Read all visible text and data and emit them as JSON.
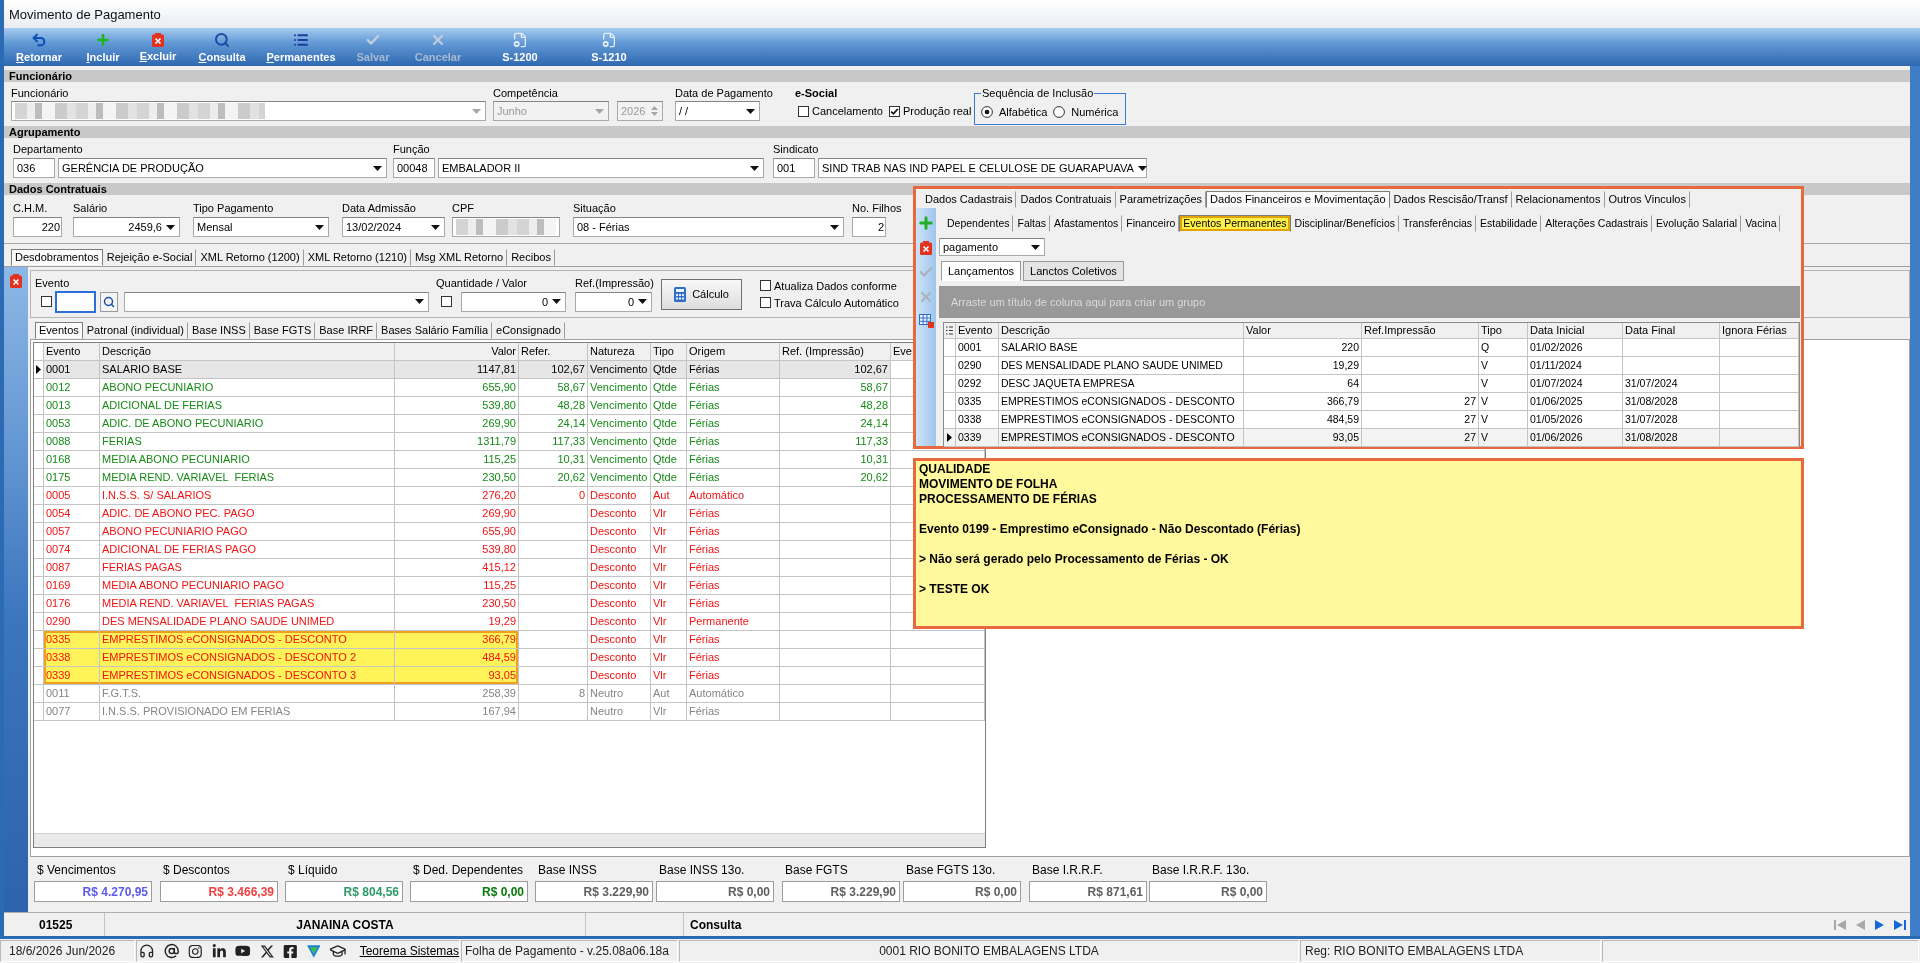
{
  "window": {
    "title": "Movimento de Pagamento"
  },
  "toolbar": [
    {
      "label": "Retornar",
      "kind": "back",
      "shortcut": true,
      "disabled": false
    },
    {
      "label": "Incluir",
      "kind": "add",
      "shortcut": true,
      "disabled": false
    },
    {
      "label": "Excluir",
      "kind": "delete",
      "shortcut": true,
      "disabled": false
    },
    {
      "label": "Consulta",
      "kind": "search",
      "shortcut": true,
      "disabled": false
    },
    {
      "label": "Permanentes",
      "kind": "list",
      "shortcut": true,
      "disabled": false
    },
    {
      "label": "Salvar",
      "kind": "save",
      "shortcut": false,
      "disabled": true
    },
    {
      "label": "Cancelar",
      "kind": "cancel",
      "shortcut": false,
      "disabled": true
    },
    {
      "label": "S-1200",
      "kind": "document",
      "shortcut": false,
      "disabled": false
    },
    {
      "label": "S-1210",
      "kind": "document",
      "shortcut": false,
      "disabled": false
    }
  ],
  "funcionario": {
    "header": "Funcionário",
    "employee": {
      "label": "Funcionário",
      "disabled": true
    },
    "competencia": {
      "label": "Competência",
      "value": "Junho",
      "year": "2026",
      "disabled": true
    },
    "data_pagamento": {
      "label": "Data de Pagamento",
      "value": "/ /"
    },
    "esocial": {
      "label": "e-Social",
      "options": [
        {
          "label": "Cancelamento",
          "checked": false
        },
        {
          "label": "Produção real",
          "checked": true
        }
      ]
    },
    "sequencia": {
      "label": "Sequência de Inclusão",
      "options": [
        {
          "label": "Alfabética",
          "selected": true
        },
        {
          "label": "Numérica",
          "selected": false
        }
      ]
    }
  },
  "agrupamento": {
    "header": "Agrupamento",
    "fields": [
      {
        "label": "Departamento",
        "code": "036",
        "value": "GERÊNCIA DE PRODUÇÃO"
      },
      {
        "label": "Função",
        "code": "00048",
        "value": "EMBALADOR II"
      },
      {
        "label": "Sindicato",
        "code": "001",
        "value": "SIND TRAB NAS IND PAPEL E CELULOSE DE GUARAPUAVA"
      }
    ]
  },
  "dados_contratuais": {
    "header": "Dados Contratuais",
    "fields": [
      {
        "label": "C.H.M.",
        "value": "220",
        "kind": "number"
      },
      {
        "label": "Salário",
        "value": "2459,6",
        "kind": "number_dropdown"
      },
      {
        "label": "Tipo Pagamento",
        "value": "Mensal",
        "kind": "dropdown"
      },
      {
        "label": "Data Admissão",
        "value": "13/02/2024",
        "kind": "dropdown"
      },
      {
        "label": "CPF",
        "kind": "blurred"
      },
      {
        "label": "Situação",
        "value": "08 - Férias",
        "kind": "dropdown"
      },
      {
        "label": "No. Filhos",
        "value": "2",
        "kind": "number"
      }
    ]
  },
  "main_tabs": [
    {
      "label": "Desdobramentos",
      "selected": true
    },
    {
      "label": "Rejeição e-Social",
      "selected": false
    },
    {
      "label": "XML Retorno (1200)",
      "selected": false
    },
    {
      "label": "XML Retorno (1210)",
      "selected": false
    },
    {
      "label": "Msg XML Retorno",
      "selected": false
    },
    {
      "label": "Recibos",
      "selected": false
    }
  ],
  "evento_panel": {
    "evento": {
      "label": "Evento",
      "checked": false,
      "focused": true
    },
    "quantidade": {
      "label": "Quantidade / Valor",
      "checked": false,
      "value": "0"
    },
    "ref_impressao": {
      "label": "Ref.(Impressão)",
      "value": "0"
    },
    "calculate_button": "Cálculo",
    "options": [
      {
        "label": "Atualiza Dados conforme",
        "checked": false
      },
      {
        "label": "Trava Cálculo Automático",
        "checked": false
      }
    ]
  },
  "event_tabs": [
    {
      "label": "Eventos",
      "selected": true
    },
    {
      "label": "Patronal (individual)",
      "selected": false
    },
    {
      "label": "Base INSS",
      "selected": false
    },
    {
      "label": "Base FGTS",
      "selected": false
    },
    {
      "label": "Base IRRF",
      "selected": false
    },
    {
      "label": "Bases Salário Família",
      "selected": false
    },
    {
      "label": "eConsignado",
      "selected": false
    }
  ],
  "events_table": {
    "columns": [
      "Evento",
      "Descrição",
      "Valor",
      "Refer.",
      "Natureza",
      "Tipo",
      "Origem",
      "Ref. (Impressão)",
      "Eve"
    ],
    "rows": [
      {
        "evento": "0001",
        "descricao": "SALARIO BASE",
        "valor": "1147,81",
        "refer": "102,67",
        "natureza": "Vencimento",
        "tipo": "Qtde",
        "origem": "Férias",
        "ref_impressao": "102,67",
        "selected": true,
        "highlighted": false
      },
      {
        "evento": "0012",
        "descricao": "ABONO PECUNIARIO",
        "valor": "655,90",
        "refer": "58,67",
        "natureza": "Vencimento",
        "tipo": "Qtde",
        "origem": "Férias",
        "ref_impressao": "58,67",
        "kind": "vencimento",
        "selected": false,
        "highlighted": false
      },
      {
        "evento": "0013",
        "descricao": "ADICIONAL DE FERIAS",
        "valor": "539,80",
        "refer": "48,28",
        "natureza": "Vencimento",
        "tipo": "Qtde",
        "origem": "Férias",
        "ref_impressao": "48,28",
        "kind": "vencimento",
        "selected": false,
        "highlighted": false
      },
      {
        "evento": "0053",
        "descricao": "ADIC. DE ABONO PECUNIARIO",
        "valor": "269,90",
        "refer": "24,14",
        "natureza": "Vencimento",
        "tipo": "Qtde",
        "origem": "Férias",
        "ref_impressao": "24,14",
        "kind": "vencimento",
        "selected": false,
        "highlighted": false
      },
      {
        "evento": "0088",
        "descricao": "FERIAS",
        "valor": "1311,79",
        "refer": "117,33",
        "natureza": "Vencimento",
        "tipo": "Qtde",
        "origem": "Férias",
        "ref_impressao": "117,33",
        "kind": "vencimento",
        "selected": false,
        "highlighted": false
      },
      {
        "evento": "0168",
        "descricao": "MEDIA ABONO PECUNIARIO",
        "valor": "115,25",
        "refer": "10,31",
        "natureza": "Vencimento",
        "tipo": "Qtde",
        "origem": "Férias",
        "ref_impressao": "10,31",
        "kind": "vencimento",
        "selected": false,
        "highlighted": false
      },
      {
        "evento": "0175",
        "descricao": "MEDIA REND. VARIAVEL  FERIAS",
        "valor": "230,50",
        "refer": "20,62",
        "natureza": "Vencimento",
        "tipo": "Qtde",
        "origem": "Férias",
        "ref_impressao": "20,62",
        "kind": "vencimento",
        "selected": false,
        "highlighted": false
      },
      {
        "evento": "0005",
        "descricao": "I.N.S.S. S/ SALARIOS",
        "valor": "276,20",
        "refer": "0",
        "natureza": "Desconto",
        "tipo": "Aut",
        "origem": "Automático",
        "kind": "desconto",
        "selected": false,
        "highlighted": false
      },
      {
        "evento": "0054",
        "descricao": "ADIC. DE ABONO PEC. PAGO",
        "valor": "269,90",
        "natureza": "Desconto",
        "tipo": "Vlr",
        "origem": "Férias",
        "kind": "desconto",
        "selected": false,
        "highlighted": false
      },
      {
        "evento": "0057",
        "descricao": "ABONO PECUNIARIO PAGO",
        "valor": "655,90",
        "natureza": "Desconto",
        "tipo": "Vlr",
        "origem": "Férias",
        "kind": "desconto",
        "selected": false,
        "highlighted": false
      },
      {
        "evento": "0074",
        "descricao": "ADICIONAL DE FERIAS PAGO",
        "valor": "539,80",
        "natureza": "Desconto",
        "tipo": "Vlr",
        "origem": "Férias",
        "kind": "desconto",
        "selected": false,
        "highlighted": false
      },
      {
        "evento": "0087",
        "descricao": "FERIAS PAGAS",
        "valor": "415,12",
        "natureza": "Desconto",
        "tipo": "Vlr",
        "origem": "Férias",
        "kind": "desconto",
        "selected": false,
        "highlighted": false
      },
      {
        "evento": "0169",
        "descricao": "MEDIA ABONO PECUNIARIO PAGO",
        "valor": "115,25",
        "natureza": "Desconto",
        "tipo": "Vlr",
        "origem": "Férias",
        "kind": "desconto",
        "selected": false,
        "highlighted": false
      },
      {
        "evento": "0176",
        "descricao": "MEDIA REND. VARIAVEL  FERIAS PAGAS",
        "valor": "230,50",
        "natureza": "Desconto",
        "tipo": "Vlr",
        "origem": "Férias",
        "kind": "desconto",
        "selected": false,
        "highlighted": false
      },
      {
        "evento": "0290",
        "descricao": "DES MENSALIDADE PLANO SAUDE UNIMED",
        "valor": "19,29",
        "natureza": "Desconto",
        "tipo": "Vlr",
        "origem": "Permanente",
        "kind": "desconto",
        "selected": false,
        "highlighted": false
      },
      {
        "evento": "0335",
        "descricao": "EMPRESTIMOS eCONSIGNADOS - DESCONTO",
        "valor": "366,79",
        "natureza": "Desconto",
        "tipo": "Vlr",
        "origem": "Férias",
        "kind": "desconto",
        "selected": false,
        "highlighted": true
      },
      {
        "evento": "0338",
        "descricao": "EMPRESTIMOS eCONSIGNADOS - DESCONTO 2",
        "valor": "484,59",
        "natureza": "Desconto",
        "tipo": "Vlr",
        "origem": "Férias",
        "kind": "desconto",
        "selected": false,
        "highlighted": true
      },
      {
        "evento": "0339",
        "descricao": "EMPRESTIMOS eCONSIGNADOS - DESCONTO 3",
        "valor": "93,05",
        "natureza": "Desconto",
        "tipo": "Vlr",
        "origem": "Férias",
        "kind": "desconto",
        "selected": false,
        "highlighted": true
      },
      {
        "evento": "0011",
        "descricao": "F.G.T.S.",
        "valor": "258,39",
        "refer": "8",
        "natureza": "Neutro",
        "tipo": "Aut",
        "origem": "Automático",
        "kind": "neutro",
        "selected": false,
        "highlighted": false
      },
      {
        "evento": "0077",
        "descricao": "I.N.S.S. PROVISIONADO EM FERIAS",
        "valor": "167,94",
        "natureza": "Neutro",
        "tipo": "Vlr",
        "origem": "Férias",
        "kind": "neutro",
        "selected": false,
        "highlighted": false
      }
    ]
  },
  "totals": [
    {
      "label": "$ Vencimentos",
      "value": "R$ 4.270,95",
      "color": "#5a5af0"
    },
    {
      "label": "$ Descontos",
      "value": "R$ 3.466,39",
      "color": "#f04040"
    },
    {
      "label": "$ Líquido",
      "value": "R$ 804,56",
      "color": "#2e9a6a"
    },
    {
      "label": "$ Ded. Dependentes",
      "value": "R$ 0,00",
      "color": "#0a7a0a"
    },
    {
      "label": "Base INSS",
      "value": "R$ 3.229,90",
      "color": "#5f5f5f"
    },
    {
      "label": "Base INSS 13o.",
      "value": "R$ 0,00",
      "color": "#5f5f5f"
    },
    {
      "label": "Base FGTS",
      "value": "R$ 3.229,90",
      "color": "#5f5f5f"
    },
    {
      "label": "Base FGTS 13o.",
      "value": "R$ 0,00",
      "color": "#5f5f5f"
    },
    {
      "label": "Base I.R.R.F.",
      "value": "R$ 871,61",
      "color": "#5f5f5f"
    },
    {
      "label": "Base I.R.R.F. 13o.",
      "value": "R$ 0,00",
      "color": "#5f5f5f"
    }
  ],
  "record_bar": {
    "code": "01525",
    "name": "JANAINA COSTA",
    "mode": "Consulta",
    "nav": [
      {
        "kind": "first",
        "disabled": true
      },
      {
        "kind": "previous",
        "disabled": true
      },
      {
        "kind": "next",
        "disabled": false
      },
      {
        "kind": "last",
        "disabled": false
      }
    ]
  },
  "employee_panel": {
    "tabs": [
      {
        "label": "Dados Cadastrais",
        "selected": false
      },
      {
        "label": "Dados Contratuais",
        "selected": false
      },
      {
        "label": "Parametrizações",
        "selected": false
      },
      {
        "label": "Dados Financeiros e Movimentação",
        "selected": true
      },
      {
        "label": "Dados Rescisão/Transf",
        "selected": false
      },
      {
        "label": "Relacionamentos",
        "selected": false
      },
      {
        "label": "Outros Vinculos",
        "selected": false
      }
    ],
    "tools": [
      {
        "kind": "add",
        "disabled": false
      },
      {
        "kind": "delete",
        "disabled": false
      },
      {
        "kind": "save",
        "disabled": true
      },
      {
        "kind": "cancel",
        "disabled": true
      },
      {
        "kind": "grid",
        "disabled": false
      }
    ],
    "subtabs": [
      {
        "label": "Dependentes",
        "selected": false,
        "highlighted": false
      },
      {
        "label": "Faltas",
        "selected": false,
        "highlighted": false
      },
      {
        "label": "Afastamentos",
        "selected": false,
        "highlighted": false
      },
      {
        "label": "Financeiro",
        "selected": false,
        "highlighted": false
      },
      {
        "label": "Eventos Permanentes",
        "selected": true,
        "highlighted": true
      },
      {
        "label": "Disciplinar/Benefícios",
        "selected": false,
        "highlighted": false
      },
      {
        "label": "Transferências",
        "selected": false,
        "highlighted": false
      },
      {
        "label": "Estabilidade",
        "selected": false,
        "highlighted": false
      },
      {
        "label": "Alterações Cadastrais",
        "selected": false,
        "highlighted": false
      },
      {
        "label": "Evolução Salarial",
        "selected": false,
        "highlighted": false
      },
      {
        "label": "Vacina",
        "selected": false,
        "highlighted": false
      }
    ],
    "filter": {
      "value": "pagamento"
    },
    "grid_tabs": [
      {
        "label": "Lançamentos",
        "selected": true
      },
      {
        "label": "Lanctos Coletivos",
        "selected": false
      }
    ],
    "group_hint": "Arraste um título de coluna aqui para criar um grupo",
    "grid": {
      "columns": [
        "Evento",
        "Descrição",
        "Valor",
        "Ref.Impressão",
        "Tipo",
        "Data Inicial",
        "Data Final",
        "Ignora Férias"
      ],
      "rows": [
        {
          "evento": "0001",
          "descricao": "SALARIO BASE",
          "valor": "220",
          "tipo": "Q",
          "data_inicial": "01/02/2026",
          "selected": false
        },
        {
          "evento": "0290",
          "descricao": "DES MENSALIDADE PLANO SAUDE UNIMED",
          "valor": "19,29",
          "tipo": "V",
          "data_inicial": "01/11/2024",
          "selected": false
        },
        {
          "evento": "0292",
          "descricao": "DESC JAQUETA EMPRESA",
          "valor": "64",
          "tipo": "V",
          "data_inicial": "01/07/2024",
          "data_final": "31/07/2024",
          "selected": false
        },
        {
          "evento": "0335",
          "descricao": "EMPRESTIMOS eCONSIGNADOS - DESCONTO",
          "valor": "366,79",
          "ref_impressao": "27",
          "tipo": "V",
          "data_inicial": "01/06/2025",
          "data_final": "31/08/2028",
          "selected": false
        },
        {
          "evento": "0338",
          "descricao": "EMPRESTIMOS eCONSIGNADOS - DESCONTO",
          "valor": "484,59",
          "ref_impressao": "27",
          "tipo": "V",
          "data_inicial": "01/05/2026",
          "data_final": "31/07/2028",
          "selected": false
        },
        {
          "evento": "0339",
          "descricao": "EMPRESTIMOS eCONSIGNADOS - DESCONTO",
          "valor": "93,05",
          "ref_impressao": "27",
          "tipo": "V",
          "data_inicial": "01/06/2026",
          "data_final": "31/08/2028",
          "selected": true
        }
      ]
    }
  },
  "note": {
    "paragraphs": [
      [
        "QUALIDADE",
        "MOVIMENTO DE FOLHA",
        "PROCESSAMENTO DE FÉRIAS"
      ],
      [
        "Evento 0199 - Emprestimo eConsignado - Não Descontado (Férias)"
      ],
      [
        "> Não será gerado pelo Processamento de Férias - OK"
      ],
      [
        "> TESTE OK"
      ]
    ]
  },
  "status_bar": {
    "date": "18/6/2026 Jun/2026",
    "link": "Teorema Sistemas",
    "version": "Folha de Pagamento - v.25.08a06.18a",
    "company": "0001 RIO BONITO EMBALAGENS LTDA",
    "registry": "Reg: RIO BONITO EMBALAGENS LTDA"
  }
}
